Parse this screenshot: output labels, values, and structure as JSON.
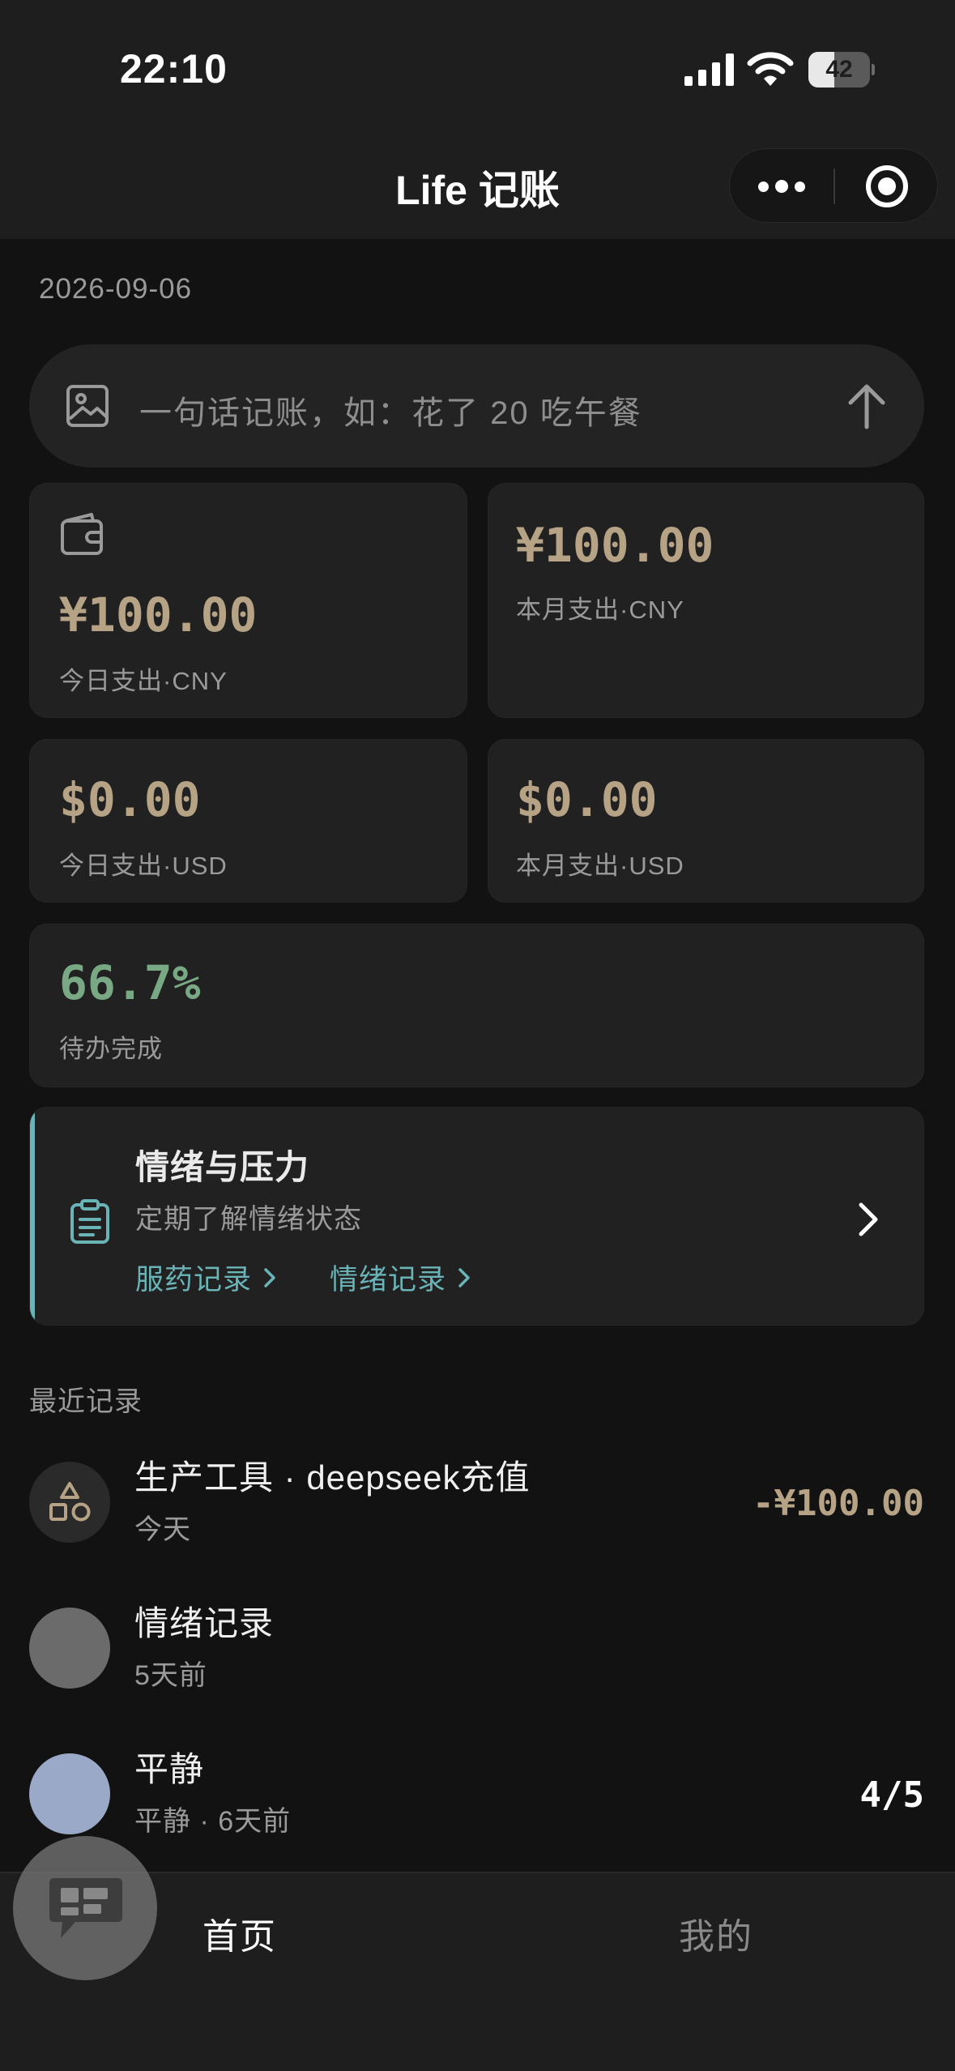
{
  "status_bar": {
    "time": "22:10",
    "battery": "42",
    "battery_level": 0.42,
    "icons": [
      "signal-icon",
      "wifi-icon",
      "battery-icon"
    ]
  },
  "nav": {
    "title": "Life 记账",
    "icons": [
      "more-icon",
      "target-icon"
    ]
  },
  "date": "2026-09-06",
  "quick_input": {
    "placeholder": "一句话记账，如：花了 20 吃午餐",
    "icons": [
      "image-icon",
      "send-arrow-icon"
    ]
  },
  "stats": {
    "today_cny": {
      "value": "¥100.00",
      "label": "今日支出·CNY",
      "icon": "wallet-icon"
    },
    "month_cny": {
      "value": "¥100.00",
      "label": "本月支出·CNY"
    },
    "today_usd": {
      "value": "$0.00",
      "label": "今日支出·USD"
    },
    "month_usd": {
      "value": "$0.00",
      "label": "本月支出·USD"
    },
    "todo": {
      "value": "66.7%",
      "label": "待办完成"
    }
  },
  "emotion_card": {
    "title": "情绪与压力",
    "subtitle": "定期了解情绪状态",
    "links": [
      "服药记录",
      "情绪记录"
    ],
    "accent": "#6ab3b6",
    "icons": [
      "clipboard-icon",
      "chevron-right-icon"
    ]
  },
  "recent": {
    "title": "最近记录",
    "items": [
      {
        "title": "生产工具 · deepseek充值",
        "sub": "今天",
        "value": "-¥100.00",
        "avatar": "shapes-icon",
        "color": "#2a2a2a"
      },
      {
        "title": "情绪记录",
        "sub": "5天前",
        "value": "",
        "avatar": "",
        "color": "#6b6b6b"
      },
      {
        "title": "平静",
        "sub": "平静 · 6天前",
        "value": "4/5",
        "avatar": "",
        "color": "#9aa9c7"
      }
    ]
  },
  "tabbar": {
    "items": [
      "首页",
      "我的"
    ],
    "active": "首页"
  },
  "fab": {
    "icon": "chat-icon"
  },
  "colors": {
    "amount": "#b6a285",
    "percent": "#78a884",
    "background": "#121212",
    "card": "#212121"
  }
}
